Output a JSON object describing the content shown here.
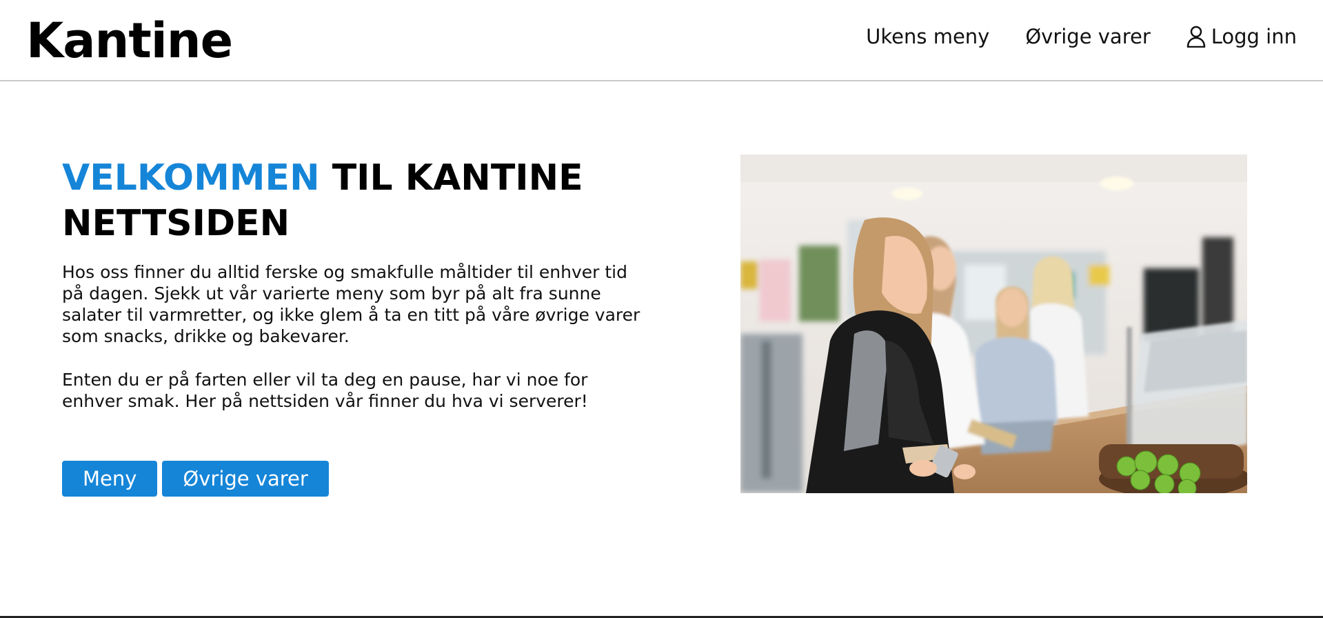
{
  "header": {
    "brand": "Kantine",
    "nav": [
      {
        "label": "Ukens meny"
      },
      {
        "label": "Øvrige varer"
      },
      {
        "label": "Logg inn",
        "icon": "user-icon"
      }
    ]
  },
  "hero": {
    "title_accent": "VELKOMMEN",
    "title_rest": " TIL KANTINE NETTSIDEN",
    "paragraph1": "Hos oss finner du alltid ferske og smakfulle måltider til enhver tid på dagen. Sjekk ut vår varierte meny som byr på alt fra sunne salater til varmretter, og ikke glem å ta en titt på våre øvrige varer som snacks, drikke og bakevarer.",
    "paragraph2": "Enten du er på farten eller vil ta deg en pause, har vi noe for enhver smak. Her på nettsiden vår finner du hva vi serverer!",
    "buttons": {
      "menu": "Meny",
      "other": "Øvrige varer"
    }
  },
  "colors": {
    "accent": "#1585d8",
    "text": "#111111",
    "header_border": "#c9c9c9"
  }
}
